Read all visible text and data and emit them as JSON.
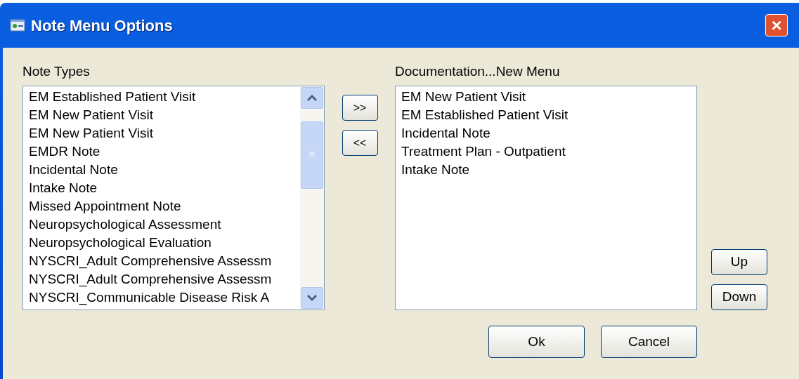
{
  "window": {
    "title": "Note Menu Options",
    "close": "×"
  },
  "note_types": {
    "label": "Note Types",
    "items": [
      {
        "text": "EM Established Patient Visit"
      },
      {
        "text": "EM New Patient Visit"
      },
      {
        "text": "EM New Patient Visit"
      },
      {
        "text": "EMDR Note"
      },
      {
        "text": "Incidental Note"
      },
      {
        "text": "Intake Note"
      },
      {
        "text": "Missed Appointment Note"
      },
      {
        "text": "Neuropsychological Assessment"
      },
      {
        "text": "Neuropsychological Evaluation"
      },
      {
        "text": "NYSCRI_Adult Comprehensive Assessm"
      },
      {
        "text": "NYSCRI_Adult Comprehensive Assessm"
      },
      {
        "text": "NYSCRI_Communicable Disease Risk A"
      }
    ]
  },
  "move_buttons": [
    ">>",
    "<<"
  ],
  "menu": {
    "label": "Documentation...New Menu",
    "items": [
      {
        "text": "EM New Patient Visit"
      },
      {
        "text": "EM Established Patient Visit"
      },
      {
        "text": "Incidental Note"
      },
      {
        "text": "Treatment Plan - Outpatient"
      },
      {
        "text": "Intake Note"
      }
    ]
  },
  "order_buttons": [
    "Up",
    "Down"
  ],
  "buttons": [
    "Ok",
    "Cancel"
  ]
}
